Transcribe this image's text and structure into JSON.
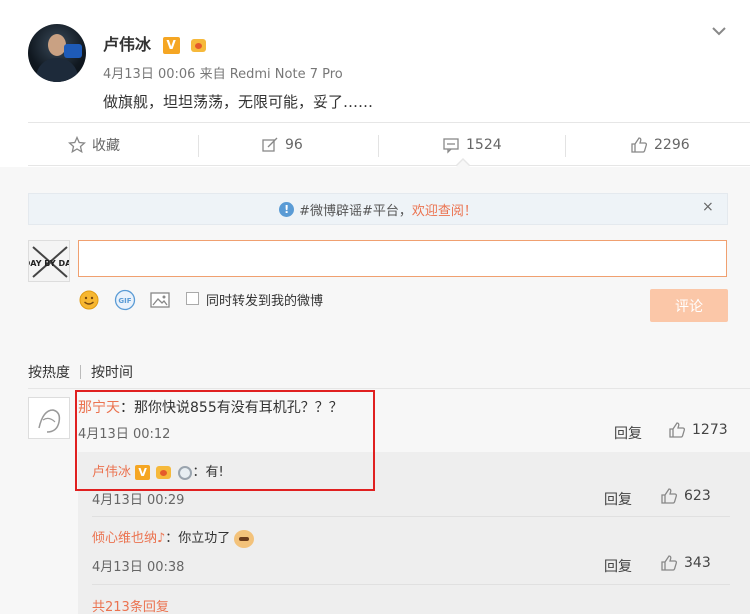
{
  "post": {
    "author": "卢伟冰",
    "verified": "V",
    "time": "4月13日 00:06",
    "source": "来自 Redmi Note 7 Pro",
    "text": "做旗舰，坦坦荡荡，无限可能，妥了……"
  },
  "actions": {
    "favorite": "收藏",
    "repost_count": "96",
    "comment_count": "1524",
    "like_count": "2296"
  },
  "notice": {
    "text": "#微博辟谣#平台，",
    "link": "欢迎查阅！",
    "close": "×"
  },
  "composer": {
    "avatar_label": "DAY BY DAY",
    "forward_label": "同时转发到我的微博",
    "submit_label": "评论",
    "gif_label": "GIF"
  },
  "sort": {
    "by_hot": "按热度",
    "by_time": "按时间"
  },
  "comment": {
    "user": "那宁天",
    "text": "：那你快说855有没有耳机孔？？？",
    "date": "4月13日 00:12",
    "reply": "回复",
    "likes": "1273"
  },
  "replies": [
    {
      "user": "卢伟冰",
      "verified": "V",
      "text": "：有!",
      "date": "4月13日 00:29",
      "reply": "回复",
      "likes": "623"
    },
    {
      "user": "倾心维也纳♪",
      "text": "：你立功了",
      "date": "4月13日 00:38",
      "reply": "回复",
      "likes": "343"
    }
  ],
  "more_replies": "共213条回复",
  "colors": {
    "accent": "#eb7350",
    "highlight_box": "#e02020",
    "submit_disabled": "#fbc7a8"
  }
}
